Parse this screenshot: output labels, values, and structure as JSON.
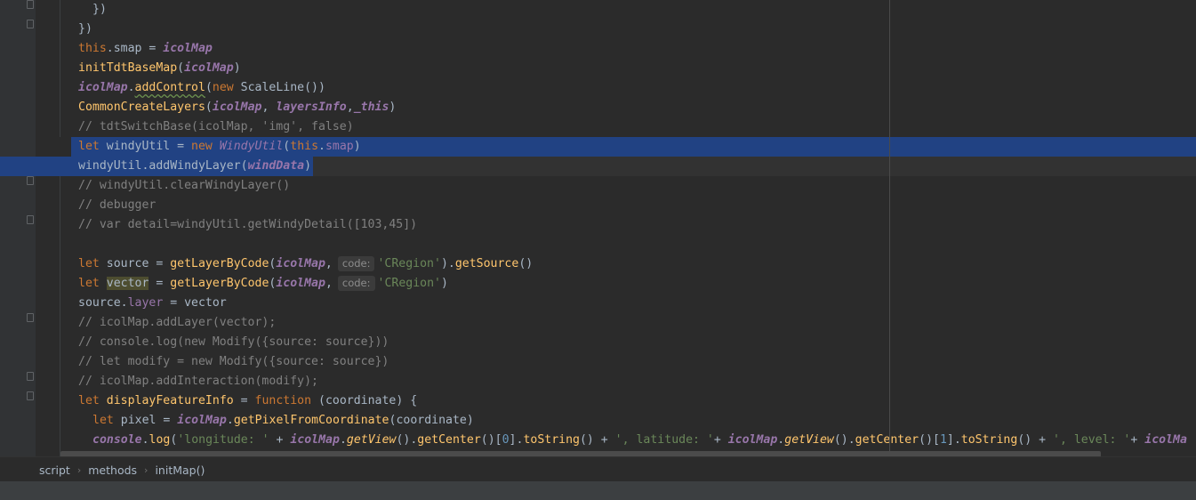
{
  "editor": {
    "code_lines": [
      "  })",
      "})",
      "this.smap = icolMap",
      "initTdtBaseMap(icolMap)",
      "icolMap.addControl(new ScaleLine())",
      "CommonCreateLayers(icolMap, layersInfo,_this)",
      "// tdtSwitchBase(icolMap, 'img', false)",
      "let windyUtil = new WindyUtil(this.smap)",
      "windyUtil.addWindyLayer(windData)",
      "// windyUtil.clearWindyLayer()",
      "// debugger",
      "// var detail=windyUtil.getWindyDetail([103,45])",
      "",
      "let source = getLayerByCode(icolMap, code: 'CRegion').getSource()",
      "let vector = getLayerByCode(icolMap, code: 'CRegion')",
      "source.layer = vector",
      "// icolMap.addLayer(vector);",
      "// console.log(new Modify({source: source}))",
      "// let modify = new Modify({source: source})",
      "// icolMap.addInteraction(modify);",
      "let displayFeatureInfo = function (coordinate) {",
      "  let pixel = icolMap.getPixelFromCoordinate(coordinate)",
      "  console.log('longitude: ' + icolMap.getView().getCenter()[0].toString() + ', latitude: '+ icolMap.getView().getCenter()[1].toString() + ', level: '+ icolMap"
    ],
    "tokens": {
      "t_close_inner": "})",
      "t_close": "})",
      "l3_this": "this",
      "l3_rest": ".smap = ",
      "l3_var": "icolMap",
      "l4_fn": "initTdtBaseMap",
      "l4_p1": "(",
      "l4_var": "icolMap",
      "l4_p2": ")",
      "l5_var": "icolMap",
      "l5_dot": ".",
      "l5_fn": "addControl",
      "l5_p1": "(",
      "l5_new": "new",
      "l5_rest": " ScaleLine())",
      "l6_fn": "CommonCreateLayers",
      "l6_p1": "(",
      "l6_v1": "icolMap",
      "l6_c1": ", ",
      "l6_v2": "layersInfo",
      "l6_c2": ",",
      "l6_v3": "_this",
      "l6_p2": ")",
      "l7_cm": "// tdtSwitchBase(icolMap, 'img', false)",
      "l8_let": "let",
      "l8_a": " windyUtil = ",
      "l8_new": "new",
      "l8_sp": " ",
      "l8_cls": "WindyUtil",
      "l8_p1": "(",
      "l8_this": "this",
      "l8_dot": ".",
      "l8_prop": "smap",
      "l8_p2": ")",
      "l9_a": "windyUtil.addWindyLayer(",
      "l9_v": "windData",
      "l9_p": ")",
      "l10_cm": "// windyUtil.clearWindyLayer()",
      "l11_cm": "// debugger",
      "l12_cm": "// var detail=windyUtil.getWindyDetail([103,45])",
      "l14_let": "let",
      "l14_a": " source = ",
      "l14_fn": "getLayerByCode",
      "l14_p1": "(",
      "l14_v": "icolMap",
      "l14_c": ",",
      "l14_hint": "code:",
      "l14_str": "'CRegion'",
      "l14_p2": ").",
      "l14_fn2": "getSource",
      "l14_p3": "()",
      "l15_let": "let",
      "l15_sp": " ",
      "l15_vec": "vector",
      "l15_a": " = ",
      "l15_fn": "getLayerByCode",
      "l15_p1": "(",
      "l15_v": "icolMap",
      "l15_c": ",",
      "l15_hint": "code:",
      "l15_str": "'CRegion'",
      "l15_p2": ")",
      "l16_a": "source.",
      "l16_prop": "layer",
      "l16_b": " = vector",
      "l17_cm": "// icolMap.addLayer(vector);",
      "l18_cm": "// console.log(new Modify({source: source}))",
      "l19_cm": "// let modify = new Modify({source: source})",
      "l20_cm": "// icolMap.addInteraction(modify);",
      "l21_let": "let",
      "l21_sp": " ",
      "l21_fn": "displayFeatureInfo",
      "l21_eq": " = ",
      "l21_func": "function",
      "l21_rest": " (coordinate) {",
      "l22_let": "let",
      "l22_a": " pixel = ",
      "l22_v": "icolMap",
      "l22_dot": ".",
      "l22_fn": "getPixelFromCoordinate",
      "l22_rest": "(coordinate)",
      "l23_console": "console",
      "l23_dot": ".",
      "l23_log": "log",
      "l23_p": "(",
      "l23_s1": "'longitude: '",
      "l23_plus1": " + ",
      "l23_v1": "icolMap",
      "l23_d1": ".",
      "l23_gv1": "getView",
      "l23_m1": "().",
      "l23_gc1": "getCenter",
      "l23_m2": "()[",
      "l23_n0": "0",
      "l23_m3": "].",
      "l23_ts1": "toString",
      "l23_m4": "() + ",
      "l23_s2": "', latitude: '",
      "l23_plus2": "+ ",
      "l23_v2": "icolMap",
      "l23_d2": ".",
      "l23_gv2": "getView",
      "l23_m5": "().",
      "l23_gc2": "getCenter",
      "l23_m6": "()[",
      "l23_n1": "1",
      "l23_m7": "].",
      "l23_ts2": "toString",
      "l23_m8": "() + ",
      "l23_s3": "', level: '",
      "l23_plus3": "+ ",
      "l23_v3": "icolMa"
    }
  },
  "breadcrumb": {
    "items": [
      "script",
      "methods",
      "initMap()"
    ],
    "separator": "›"
  },
  "colors": {
    "background": "#2b2b2b",
    "selection": "#214283",
    "keyword": "#cc7832",
    "function": "#ffc66d",
    "variable": "#9876aa",
    "string": "#6a8759",
    "comment": "#808080",
    "number": "#6897bb"
  }
}
